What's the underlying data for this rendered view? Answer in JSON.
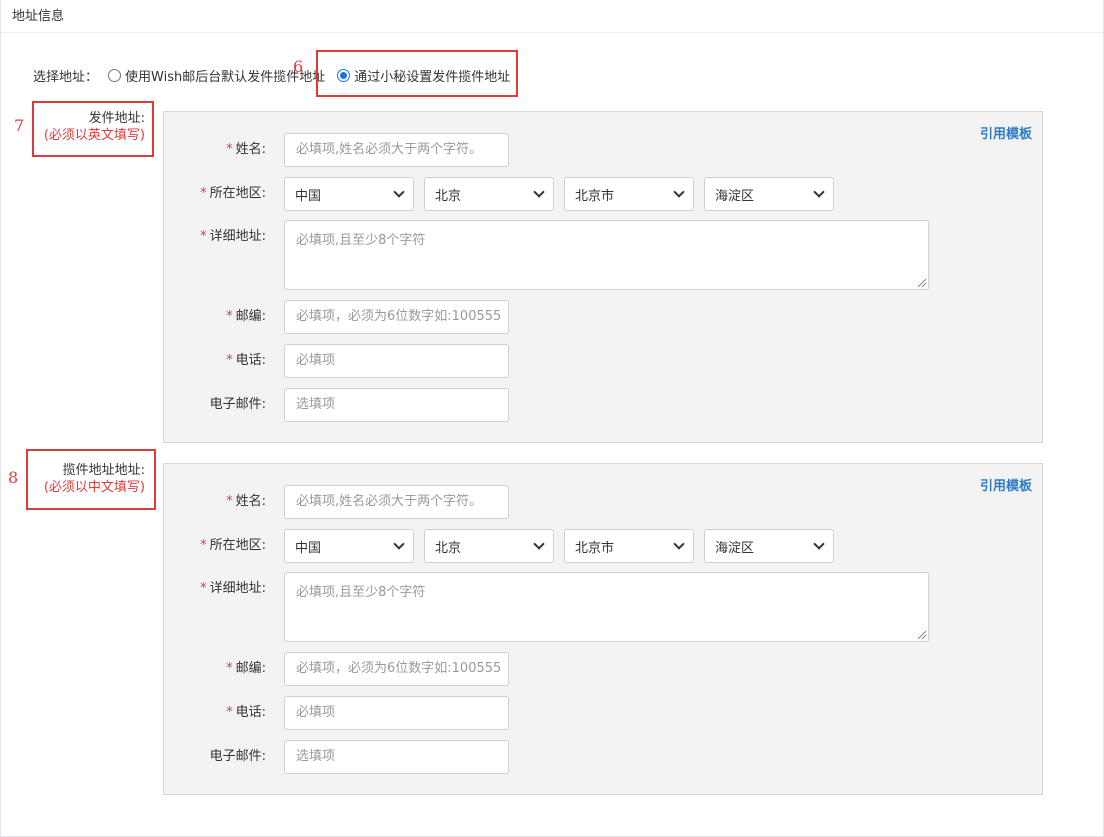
{
  "section": {
    "title": "地址信息"
  },
  "address_choice": {
    "label": "选择地址：",
    "options": [
      {
        "label": "使用Wish邮后台默认发件揽件地址",
        "checked": false
      },
      {
        "label": "通过小秘设置发件揽件地址",
        "checked": true
      }
    ]
  },
  "annotations": {
    "n6": "6",
    "n7": "7",
    "n8": "8"
  },
  "sender": {
    "title": "发件地址:",
    "note": "(必须以英文填写)",
    "ref_link": "引用模板",
    "labels": {
      "name": "姓名:",
      "region": "所在地区:",
      "detail": "详细地址:",
      "zip": "邮编:",
      "phone": "电话:",
      "email": "电子邮件:"
    },
    "required_mark": "*",
    "placeholders": {
      "name": "必填项,姓名必须大于两个字符。",
      "detail": "必填项,且至少8个字符",
      "zip": "必填项，必须为6位数字如:100555",
      "phone": "必填项",
      "email": "选填项"
    },
    "region": {
      "country": "中国",
      "province": "北京",
      "city": "北京市",
      "district": "海淀区"
    }
  },
  "pickup": {
    "title": "揽件地址地址:",
    "note": "(必须以中文填写)",
    "ref_link": "引用模板",
    "labels": {
      "name": "姓名:",
      "region": "所在地区:",
      "detail": "详细地址:",
      "zip": "邮编:",
      "phone": "电话:",
      "email": "电子邮件:"
    },
    "required_mark": "*",
    "placeholders": {
      "name": "必填项,姓名必须大于两个字符。",
      "detail": "必填项,且至少8个字符",
      "zip": "必填项，必须为6位数字如:100555",
      "phone": "必填项",
      "email": "选填项"
    },
    "region": {
      "country": "中国",
      "province": "北京",
      "city": "北京市",
      "district": "海淀区"
    }
  },
  "colors": {
    "accent": "#1a73e8",
    "annotation": "#e03b3b",
    "link": "#2f7bc6",
    "panel_bg": "#f3f3f3"
  }
}
